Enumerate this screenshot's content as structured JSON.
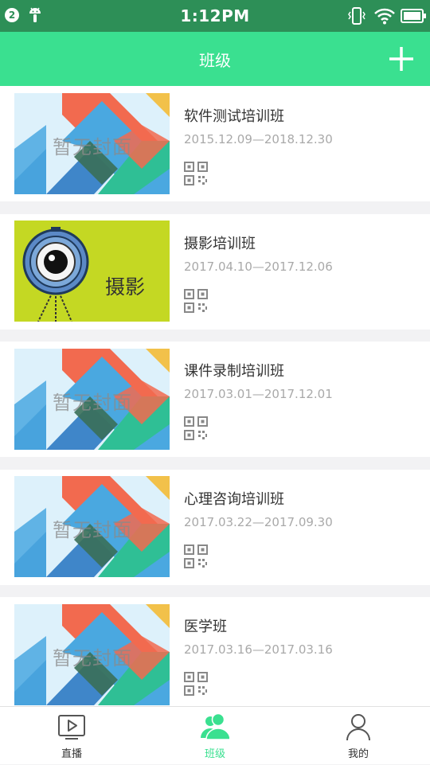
{
  "status_bar": {
    "notification_count": "2",
    "time": "1:12PM"
  },
  "header": {
    "title": "班级"
  },
  "classes": [
    {
      "title": "软件测试培训班",
      "date_range": "2015.12.09—2018.12.30",
      "cover_caption": "暂无封面"
    },
    {
      "title": "摄影培训班",
      "date_range": "2017.04.10—2017.12.06",
      "cover_caption": "摄影"
    },
    {
      "title": "课件录制培训班",
      "date_range": "2017.03.01—2017.12.01",
      "cover_caption": "暂无封面"
    },
    {
      "title": "心理咨询培训班",
      "date_range": "2017.03.22—2017.09.30",
      "cover_caption": "暂无封面"
    },
    {
      "title": "医学班",
      "date_range": "2017.03.16—2017.03.16",
      "cover_caption": "暂无封面"
    }
  ],
  "tabs": [
    {
      "label": "直播",
      "icon": "play-icon",
      "active": false
    },
    {
      "label": "班级",
      "icon": "group-icon",
      "active": true
    },
    {
      "label": "我的",
      "icon": "person-icon",
      "active": false
    }
  ],
  "colors": {
    "status_bar": "#2d8f57",
    "accent": "#3ae090",
    "background": "#f2f2f4"
  }
}
